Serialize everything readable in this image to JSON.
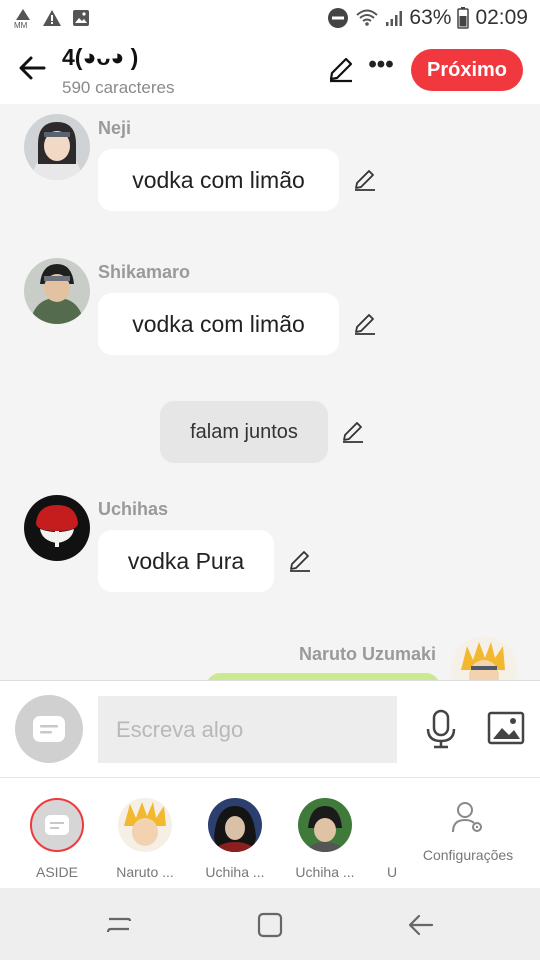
{
  "status_bar": {
    "battery": "63%",
    "time": "02:09"
  },
  "header": {
    "title": "4(◕ᴗ◕ )",
    "subtitle": "590 caracteres",
    "next_label": "Próximo"
  },
  "messages": [
    {
      "sender": "Neji",
      "text": "vodka com limão"
    },
    {
      "sender": "Shikamaro",
      "text": "vodka com limão"
    },
    {
      "sender": "",
      "text": "falam juntos"
    },
    {
      "sender": "Uchihas",
      "text": "vodka Pura"
    },
    {
      "sender": "Naruto Uzumaki",
      "text": ""
    }
  ],
  "compose": {
    "placeholder": "Escreva algo"
  },
  "roles": [
    {
      "label": "ASIDE"
    },
    {
      "label": "Naruto ..."
    },
    {
      "label": "Uchiha ..."
    },
    {
      "label": "Uchiha ..."
    },
    {
      "label": "U"
    }
  ],
  "settings_label": "Configurações",
  "colors": {
    "accent": "#f0383e",
    "own_bubble": "#cde98f",
    "background": "#f4f4f4"
  },
  "icons": [
    "back-arrow-icon",
    "pencil-icon",
    "more-icon",
    "chat-icon",
    "mic-icon",
    "image-icon",
    "settings-user-icon",
    "recents-icon",
    "home-icon",
    "back-icon"
  ]
}
